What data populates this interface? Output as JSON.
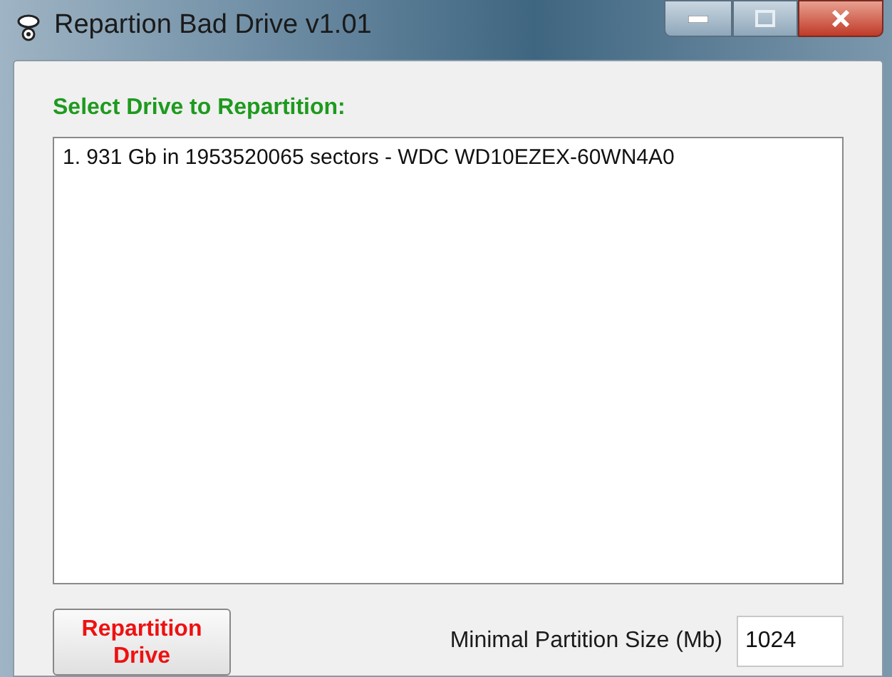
{
  "window": {
    "title": "Repartion Bad Drive v1.01"
  },
  "drive_section": {
    "label": "Select Drive to Repartition:",
    "drives": [
      {
        "text": "1. 931 Gb in 1953520065 sectors  -  WDC WD10EZEX-60WN4A0",
        "selected": false
      }
    ]
  },
  "repartition_button": {
    "label": "Repartition Drive"
  },
  "min_partition_size": {
    "label": "Minimal Partition Size (Mb)",
    "value": "1024"
  }
}
